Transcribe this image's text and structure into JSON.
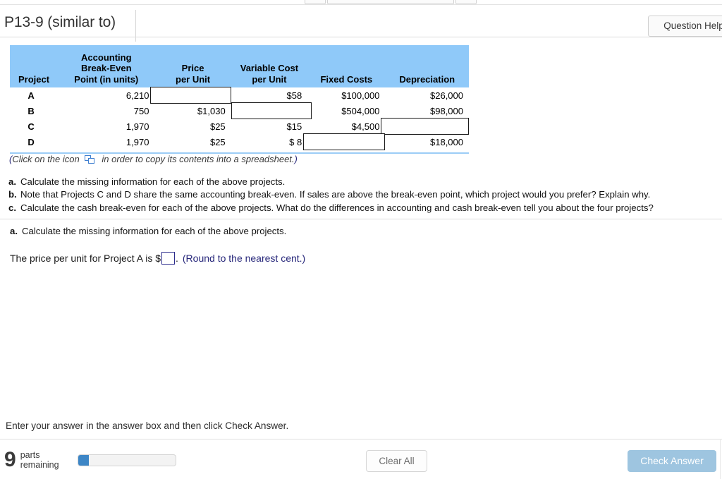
{
  "header": {
    "title": "P13-9 (similar to)",
    "question_help_label": "Question Help"
  },
  "table": {
    "columns": [
      {
        "lines": [
          "Project"
        ]
      },
      {
        "lines": [
          "Accounting",
          "Break-Even",
          "Point (in units)"
        ]
      },
      {
        "lines": [
          "Price",
          "per Unit"
        ]
      },
      {
        "lines": [
          "Variable Cost",
          "per Unit"
        ]
      },
      {
        "lines": [
          "Fixed Costs"
        ]
      },
      {
        "lines": [
          "Depreciation"
        ]
      }
    ],
    "rows": [
      {
        "project": "A",
        "bep": "6,210",
        "price": "",
        "vc": "$58",
        "fc": "$100,000",
        "dep": "$26,000"
      },
      {
        "project": "B",
        "bep": "750",
        "price": "$1,030",
        "vc": "",
        "fc": "$504,000",
        "dep": "$98,000"
      },
      {
        "project": "C",
        "bep": "1,970",
        "price": "$25",
        "vc": "$15",
        "fc": "$4,500",
        "dep": ""
      },
      {
        "project": "D",
        "bep": "1,970",
        "price": "$25",
        "vc": "$  8",
        "fc": "",
        "dep": "$18,000"
      }
    ],
    "header_bg": "#8FC9F9",
    "bottom_rule_color": "#9CCDF7"
  },
  "copy_hint": {
    "open_paren": "(",
    "text_before": "Click on the icon",
    "text_after": "in order to copy its contents into a spreadsheet.",
    "close_paren": ")",
    "icon": "copy-to-spreadsheet-icon"
  },
  "question_parts": [
    {
      "label": "a.",
      "text": "Calculate the missing information for each of the above projects."
    },
    {
      "label": "b.",
      "text": "Note that Projects C and D share the same accounting break-even.  If sales are above the break-even point, which project would you prefer?  Explain why."
    },
    {
      "label": "c.",
      "text": "Calculate the cash break-even for each of the above projects.  What do the differences in accounting and cash break-even tell you about the four projects?"
    }
  ],
  "answer": {
    "part_label": "a.",
    "part_text": "Calculate the missing information for each of the above projects.",
    "prompt_before": "The price per unit for Project A is $",
    "input_value": "",
    "prompt_after": ".",
    "round_note": "(Round to the nearest cent.)",
    "accent_color": "#26267a"
  },
  "footer": {
    "instruction": "Enter your answer in the answer box and then click Check Answer.",
    "parts_count": "9",
    "parts_label_line1": "parts",
    "parts_label_line2": "remaining",
    "progress_percent": 11,
    "progress_color": "#3d86c6",
    "clear_all_label": "Clear All",
    "check_answer_label": "Check Answer",
    "check_answer_color": "#9ec5e0"
  }
}
